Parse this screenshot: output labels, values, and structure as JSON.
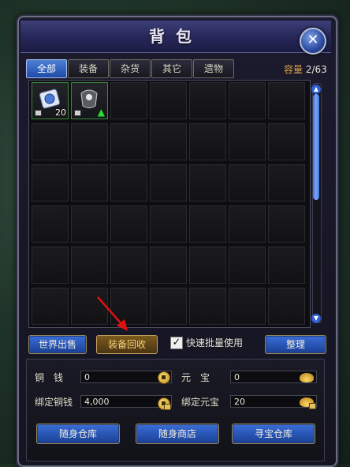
{
  "window": {
    "title": "背包"
  },
  "tabs": [
    {
      "label": "全部",
      "active": true
    },
    {
      "label": "装备",
      "active": false
    },
    {
      "label": "杂货",
      "active": false
    },
    {
      "label": "其它",
      "active": false
    },
    {
      "label": "遗物",
      "active": false
    }
  ],
  "capacity": {
    "label": "容量",
    "value": "2/63"
  },
  "inventory": {
    "items": [
      {
        "name": "scroll-item",
        "count": "20",
        "locked": true
      },
      {
        "name": "armor-item",
        "upgrade": true,
        "locked": true
      }
    ]
  },
  "actions": {
    "world_sale": "世界出售",
    "equip_recycle": "装备回收",
    "quick_batch_use": {
      "label": "快速批量使用",
      "checked": true
    },
    "sort": "整理"
  },
  "currency": {
    "copper": {
      "label": "铜　钱",
      "value": "0"
    },
    "yuanbao": {
      "label": "元　宝",
      "value": "0"
    },
    "bound_copper": {
      "label": "绑定铜钱",
      "value": "4,000"
    },
    "bound_yuanbao": {
      "label": "绑定元宝",
      "value": "20"
    }
  },
  "bottom_buttons": {
    "portable_warehouse": "随身仓库",
    "portable_shop": "随身商店",
    "treasure_warehouse": "寻宝仓库"
  },
  "colors": {
    "tab_active": "#2f63c4",
    "capacity_label": "#d9a24a",
    "item_border": "#3b8a3b",
    "annotation_arrow": "#e01010"
  }
}
